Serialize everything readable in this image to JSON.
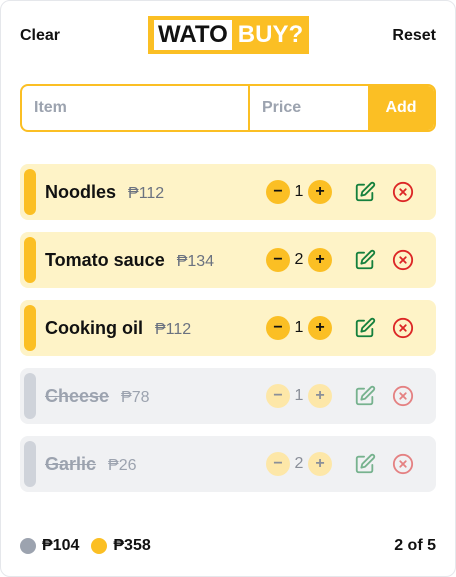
{
  "header": {
    "clear_label": "Clear",
    "reset_label": "Reset",
    "logo_word1": "WATO",
    "logo_word2": "BUY?"
  },
  "form": {
    "item_placeholder": "Item",
    "price_placeholder": "Price",
    "add_label": "Add"
  },
  "colors": {
    "accent": "#fbbf24",
    "active_bg": "#fef3c7",
    "done_bg": "#f0f1f3",
    "edit": "#15803d",
    "delete": "#dc2626"
  },
  "items": [
    {
      "name": "Noodles",
      "price": "₱112",
      "qty": "1",
      "checked": false
    },
    {
      "name": "Tomato sauce",
      "price": "₱134",
      "qty": "2",
      "checked": false
    },
    {
      "name": "Cooking oil",
      "price": "₱112",
      "qty": "1",
      "checked": false
    },
    {
      "name": "Cheese",
      "price": "₱78",
      "qty": "1",
      "checked": true
    },
    {
      "name": "Garlic",
      "price": "₱26",
      "qty": "2",
      "checked": true
    }
  ],
  "footer": {
    "bought_total": "₱104",
    "remaining_total": "₱358",
    "progress": "2 of 5"
  }
}
